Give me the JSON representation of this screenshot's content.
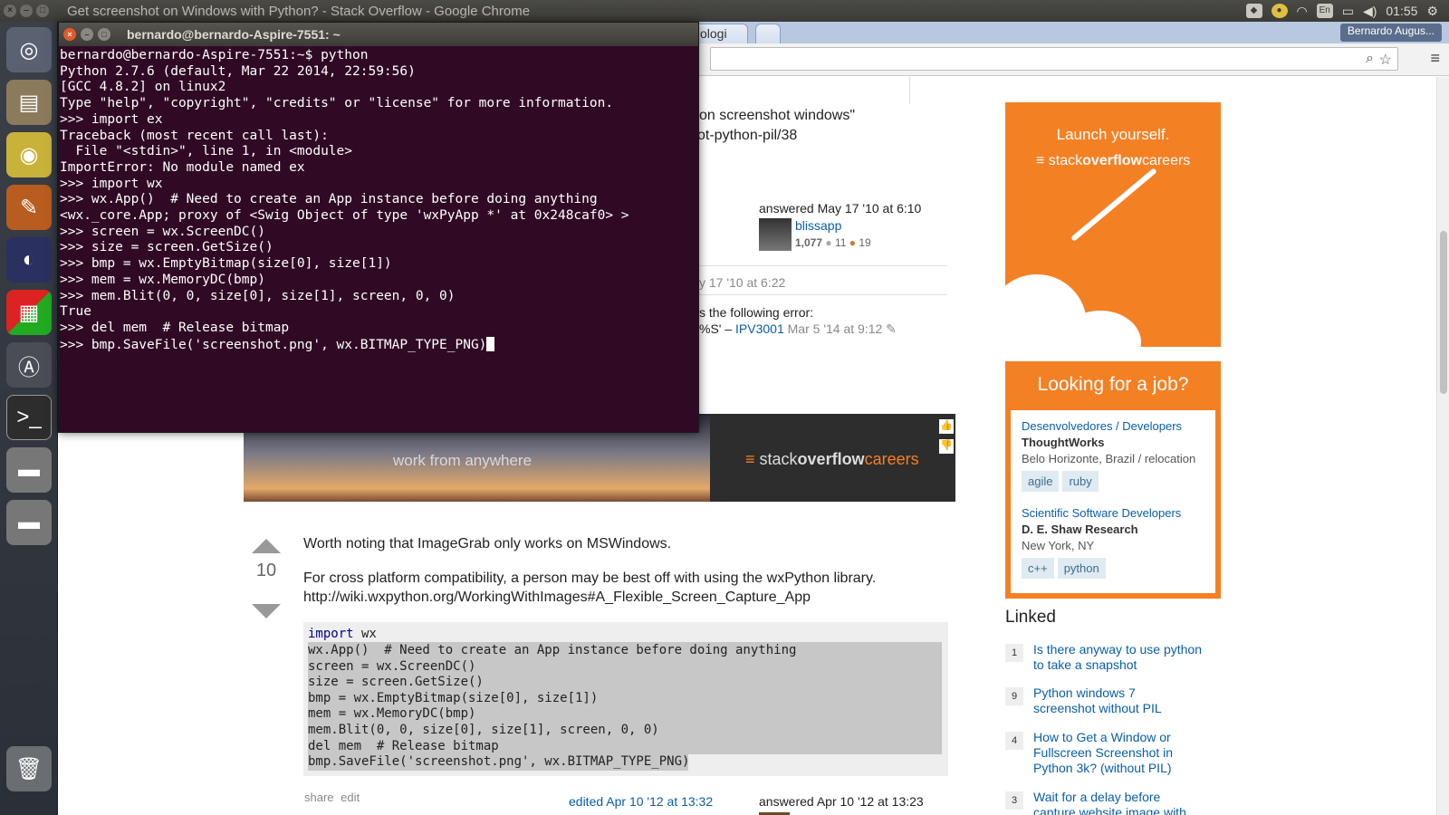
{
  "panel": {
    "window_title": "Get screenshot on Windows with Python? - Stack Overflow - Google Chrome",
    "keyboard": "En",
    "clock": "01:55"
  },
  "launcher": {
    "items": [
      "ubuntu-dash-icon",
      "files-icon",
      "chrome-icon",
      "gimp-icon",
      "eclipse-icon",
      "workspaces-icon",
      "software-updater-icon",
      "terminal-icon",
      "drive-icon",
      "drive-icon",
      "trash-icon"
    ]
  },
  "browser": {
    "tab_partial": "ologi",
    "profile": "Bernardo Augus..."
  },
  "question_fragments": {
    "line1": "on screenshot windows\"",
    "line2": "ot-python-pil/38",
    "answered": "answered May 17 '10 at 6:10",
    "user": "blissapp",
    "rep": "1,077",
    "silver": "11",
    "bronze": "19",
    "comment_date": "y 17 '10 at 6:22",
    "comment_line1": "s the following error:",
    "comment_line2": "%S' –",
    "comment_user": "IPV3001",
    "comment_time": "Mar 5 '14 at 9:12"
  },
  "banner": {
    "tagline": "work from anywhere",
    "brand_a": "stack",
    "brand_b": "overflow",
    "brand_c": "careers"
  },
  "answer": {
    "votes": "10",
    "p1": "Worth noting that ImageGrab only works on MSWindows.",
    "p2": "For cross platform compatibility, a person may be best off with using the wxPython library.",
    "link": "http://wiki.wxpython.org/WorkingWithImages#A_Flexible_Screen_Capture_App",
    "code_kw": "import",
    "code_first": " wx",
    "code_rest": "wx.App()  # Need to create an App instance before doing anything\nscreen = wx.ScreenDC()\nsize = screen.GetSize()\nbmp = wx.EmptyBitmap(size[0], size[1])\nmem = wx.MemoryDC(bmp)\nmem.Blit(0, 0, size[0], size[1], screen, 0, 0)\ndel mem  # Release bitmap\nbmp.SaveFile('screenshot.png', wx.BITMAP_TYPE_PNG)",
    "share": "share",
    "edit": "edit",
    "edited": "edited Apr 10 '12 at 13:32",
    "answered": "answered Apr 10 '12 at 13:23"
  },
  "sidebar": {
    "ad_top": "Launch yourself.",
    "ad_brand_a": "stack",
    "ad_brand_b": "overflow",
    "ad_brand_c": "careers",
    "jobs_heading": "Looking for a job?",
    "jobs": [
      {
        "title": "Desenvolvedores / Developers",
        "company": "ThoughtWorks",
        "location": "Belo Horizonte, Brazil / relocation",
        "tags": [
          "agile",
          "ruby"
        ]
      },
      {
        "title": "Scientific Software Developers",
        "company": "D. E. Shaw Research",
        "location": "New York, NY",
        "tags": [
          "c++",
          "python"
        ]
      }
    ],
    "linked_heading": "Linked",
    "linked": [
      {
        "count": "1",
        "text": "Is there anyway to use python to take a snapshot"
      },
      {
        "count": "9",
        "text": "Python windows 7 screenshot without PIL"
      },
      {
        "count": "4",
        "text": "How to Get a Window or Fullscreen Screenshot in Python 3k? (without PIL)"
      },
      {
        "count": "3",
        "text": "Wait for a delay before capture website image with"
      }
    ]
  },
  "terminal": {
    "title": "bernardo@bernardo-Aspire-7551: ~",
    "lines": [
      "bernardo@bernardo-Aspire-7551:~$ python",
      "Python 2.7.6 (default, Mar 22 2014, 22:59:56)",
      "[GCC 4.8.2] on linux2",
      "Type \"help\", \"copyright\", \"credits\" or \"license\" for more information.",
      ">>> import ex",
      "Traceback (most recent call last):",
      "  File \"<stdin>\", line 1, in <module>",
      "ImportError: No module named ex",
      ">>> import wx",
      ">>> wx.App()  # Need to create an App instance before doing anything",
      "<wx._core.App; proxy of <Swig Object of type 'wxPyApp *' at 0x248caf0> >",
      ">>> screen = wx.ScreenDC()",
      ">>> size = screen.GetSize()",
      ">>> bmp = wx.EmptyBitmap(size[0], size[1])",
      ">>> mem = wx.MemoryDC(bmp)",
      ">>> mem.Blit(0, 0, size[0], size[1], screen, 0, 0)",
      "True",
      ">>> del mem  # Release bitmap"
    ],
    "last_line": ">>> bmp.SaveFile('screenshot.png', wx.BITMAP_TYPE_PNG)"
  }
}
